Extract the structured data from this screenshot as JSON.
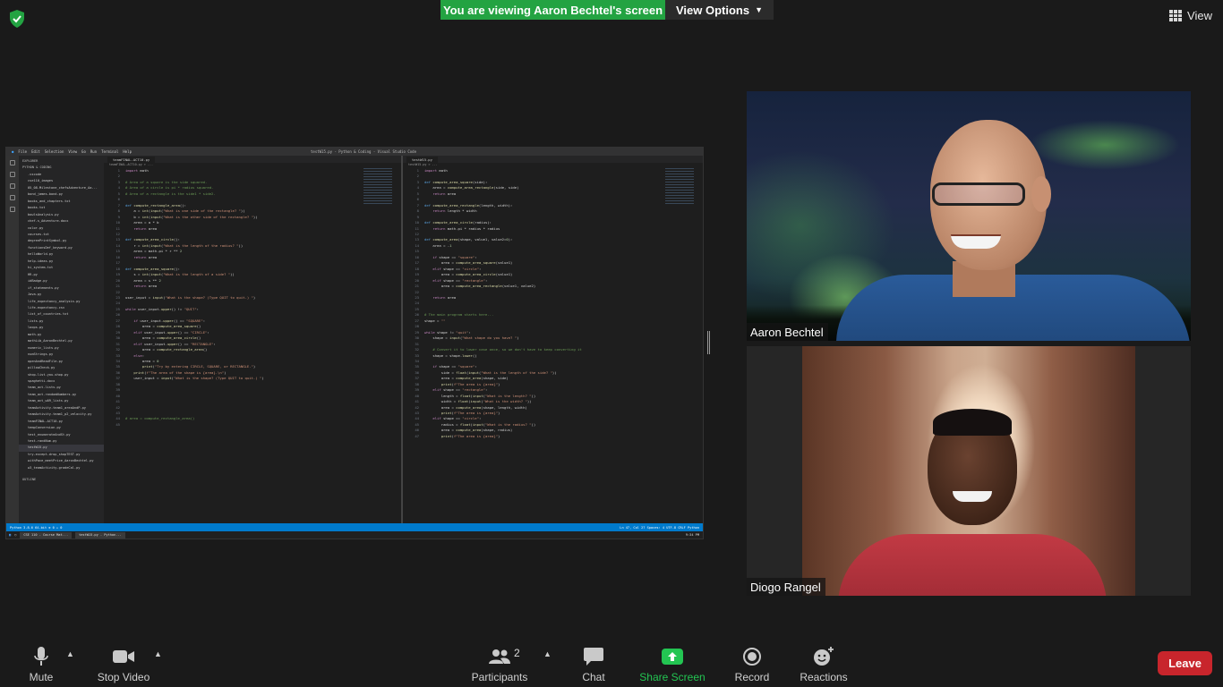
{
  "banner": {
    "viewing_text": "You are viewing Aaron Bechtel's screen",
    "view_options_label": "View Options"
  },
  "view_button_label": "View",
  "shared_screen": {
    "window_title": "testW15.py - Python & Coding - Visual Studio Code",
    "menu": [
      "File",
      "Edit",
      "Selection",
      "View",
      "Go",
      "Run",
      "Terminal",
      "Help"
    ],
    "explorer_header": "EXPLORER",
    "folder_name": "PYTHON & CODING",
    "files": [
      ".vscode",
      "cse110_images",
      "05_08-Milestone_chefsAdventure_Aa...",
      "bond_james-bond.py",
      "books_and_chapters.txt",
      "books.txt",
      "bowlsAnalysis.py",
      "chef-s_Adventure.docx",
      "color.py",
      "courses.txt",
      "degreePrintSymbol.py",
      "functionsDef_keyword.py",
      "helloWorld.py",
      "help-ideas.py",
      "hi_system.txt",
      "HR.py",
      "idBadge.py",
      "if_statements.py",
      "Java.py",
      "life_expectancy_analysis.py",
      "life-expectancy.csv",
      "list_of_countries.txt",
      "lists.py",
      "loops.py",
      "math.py",
      "mathLib_AaronBechtel.py",
      "numeric_lists.py",
      "numStrings.py",
      "openAndReadFile.py",
      "pillowCheck.py",
      "shop-list-you-shop.py",
      "spaghetti.docx",
      "team_act-lists.py",
      "team_act-randomNumbers.py",
      "team_act_w09_lists.py",
      "teamActivity-team1_areaAndP.py",
      "teamActivity-team1_p2_velocity.py",
      "teamFINAL-ACT10.py",
      "tempConversion.py",
      "test_enumerateAndSt.py",
      "test-randNum.py",
      "testW15.py",
      "try-except-drop_shopTEST.py",
      "withPace_meetPrice_AaronBechtel.py",
      "w3_teamActivity-gradeCal.py"
    ],
    "selected_file": "testW15.py",
    "outline_label": "OUTLINE",
    "left_tab": "teamFINAL-ACT10.py",
    "left_breadcrumb": "teamFINAL-ACT10.py > ...",
    "right_tab": "testW15.py",
    "right_breadcrumb": "testW15.py > ...",
    "status_left": "Python 3.8.6 64-bit   ⊗ 0 ⚠ 0",
    "status_right": "Ln 47, Col 27   Spaces: 4   UTF-8   CRLF   Python",
    "taskbar_items": [
      "CSE 110 - Course Mat...",
      "testW15.py - Python..."
    ],
    "clock": "9:34 PM"
  },
  "participants_video": [
    {
      "name": "Aaron Bechtel"
    },
    {
      "name": "Diogo Rangel"
    }
  ],
  "toolbar": {
    "mute": "Mute",
    "stop_video": "Stop Video",
    "participants": "Participants",
    "participants_count": "2",
    "chat": "Chat",
    "share_screen": "Share Screen",
    "record": "Record",
    "reactions": "Reactions",
    "leave": "Leave"
  },
  "colors": {
    "share_green": "#23a342",
    "leave_red": "#c8252c",
    "vscode_status_blue": "#007acc"
  }
}
